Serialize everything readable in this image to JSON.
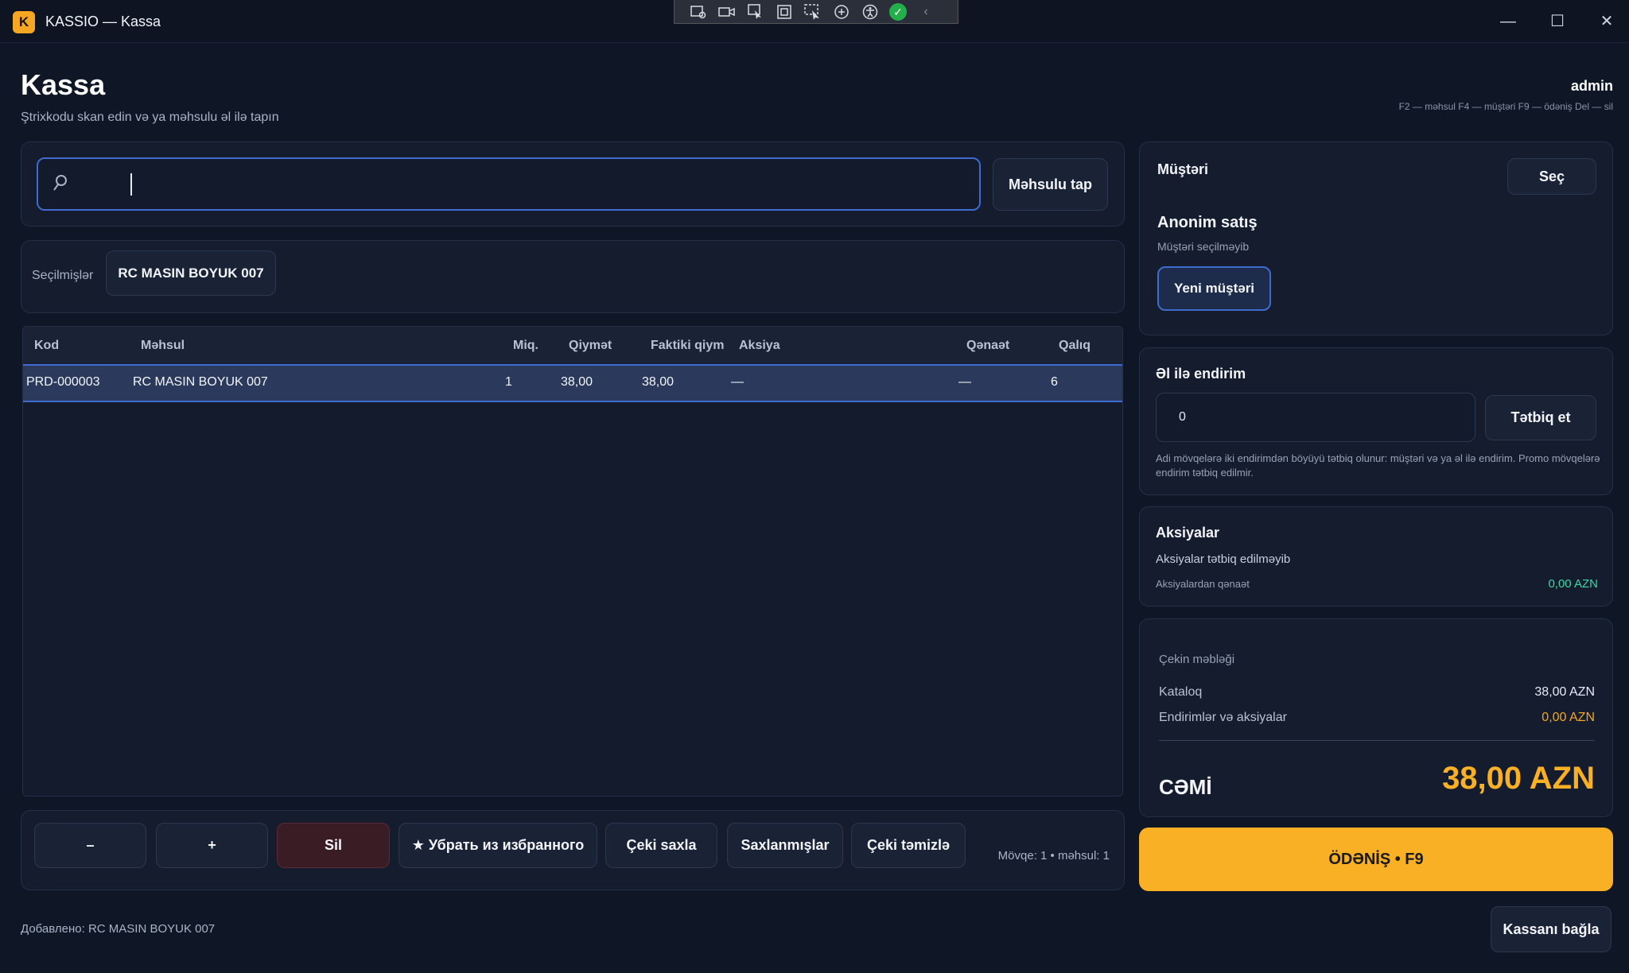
{
  "window": {
    "logo_letter": "K",
    "title": "KASSIO — Kassa",
    "controls": {
      "minimize": "—",
      "maximize": "☐",
      "close": "✕"
    }
  },
  "header": {
    "title": "Kassa",
    "subtitle": "Ştrixkodu skan edin və ya məhsulu əl ilə tapın",
    "user": "admin",
    "hotkeys": "F2 — məhsul F4 — müştəri F9 — ödəniş Del — sil"
  },
  "search": {
    "value": "",
    "placeholder": "",
    "find_button": "Məhsulu tap"
  },
  "favorites": {
    "label": "Seçilmişlər",
    "items": [
      "RC MASIN BOYUK 007"
    ]
  },
  "cart_table": {
    "columns": [
      "Kod",
      "Məhsul",
      "Miq.",
      "Qiymət",
      "Faktiki qiym",
      "Aksiya",
      "Qənaət",
      "Qalıq"
    ],
    "rows": [
      {
        "code": "PRD-000003",
        "product": "RC MASIN BOYUK 007",
        "qty": "1",
        "price": "38,00",
        "actual_price": "38,00",
        "promo": "—",
        "saving": "—",
        "stock": "6"
      }
    ]
  },
  "actions": {
    "minus": "–",
    "plus": "+",
    "delete": "Sil",
    "favorite": "★ Убрать из избранного",
    "save_receipt": "Çeki saxla",
    "saved": "Saxlanmışlar",
    "clear_receipt": "Çeki təmizlə",
    "status": "Mövqe: 1 • məhsul: 1"
  },
  "footer": {
    "message": "Добавлено: RC MASIN BOYUK 007",
    "close_register": "Kassanı bağla"
  },
  "customer": {
    "title": "Müştəri",
    "select_button": "Seç",
    "name": "Anonim satış",
    "status": "Müştəri seçilməyib",
    "new_button": "Yeni müştəri"
  },
  "manual_discount": {
    "title": "Əl ilə endirim",
    "value": "0",
    "apply_button": "Tətbiq et",
    "note": "Adi mövqelərə iki endirimdən böyüyü tətbiq olunur: müştəri və ya əl ilə endirim. Promo mövqelərə endirim tətbiq edilmir."
  },
  "promotions": {
    "title": "Aksiyalar",
    "status": "Aksiyalar tətbiq edilməyib",
    "saving_label": "Aksiyalardan qənaət",
    "saving_value": "0,00 AZN"
  },
  "receipt": {
    "title": "Çekin məbləği",
    "catalog_label": "Kataloq",
    "catalog_value": "38,00 AZN",
    "discounts_label": "Endirimlər və aksiyalar",
    "discounts_value": "0,00 AZN",
    "total_label": "CƏMİ",
    "total_value": "38,00 AZN"
  },
  "payment": {
    "button": "ÖDƏNİŞ • F9"
  },
  "colors": {
    "accent": "#f9b024",
    "focus": "#3f6ad0",
    "danger": "#3a1c24",
    "positive": "#3fd6a4"
  }
}
